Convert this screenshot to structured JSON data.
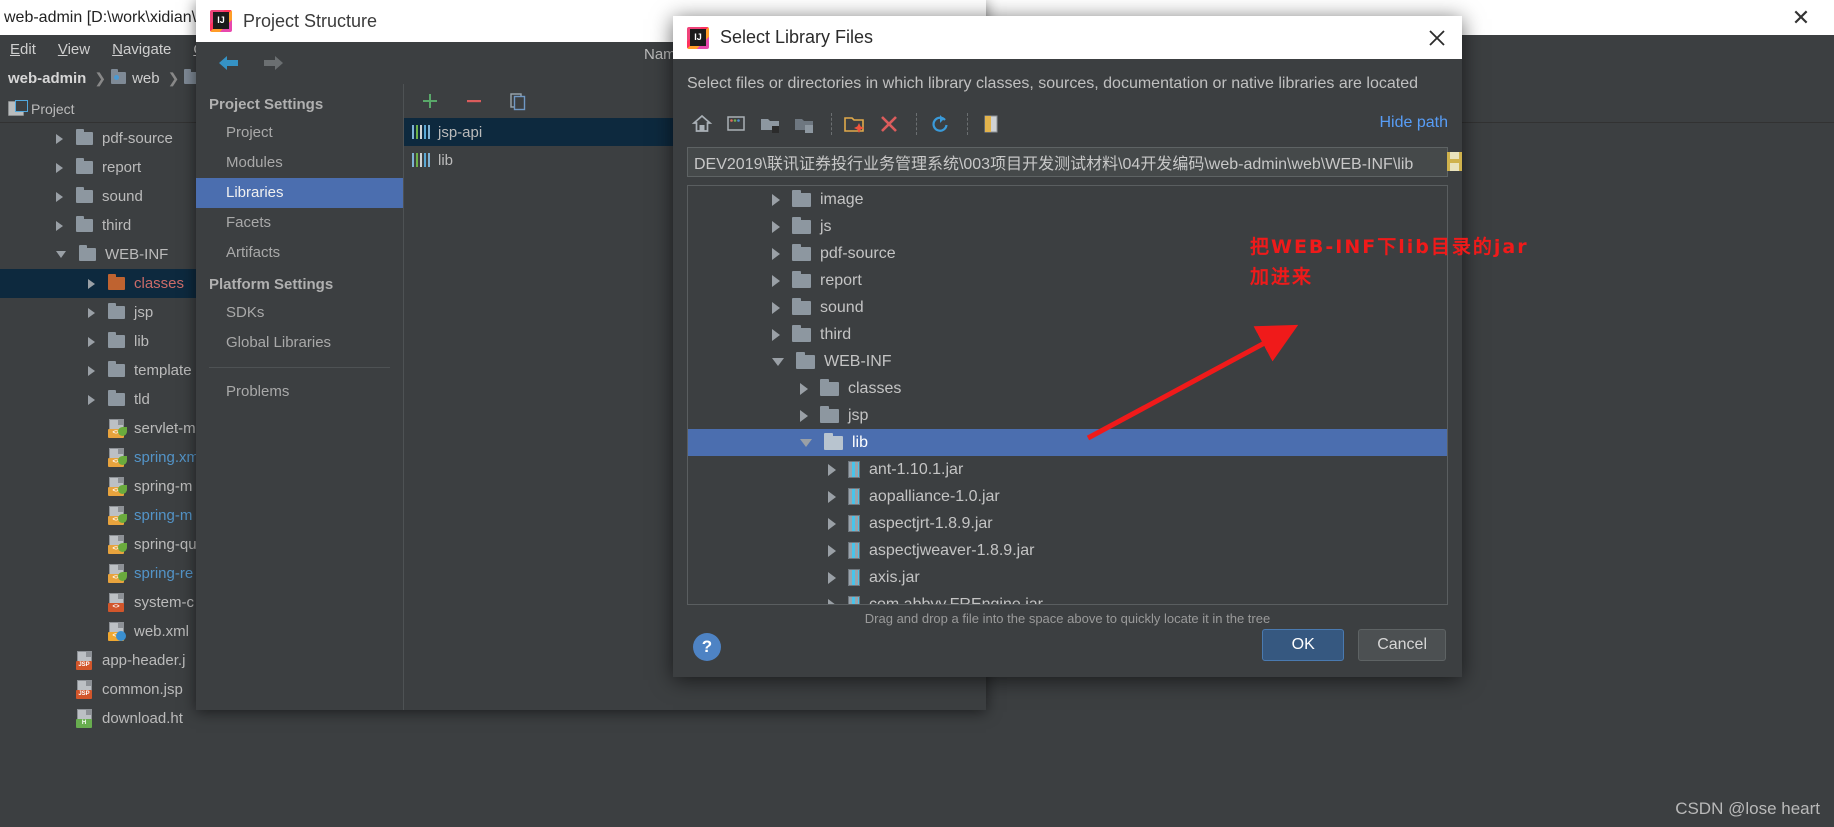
{
  "ide": {
    "title": "web-admin [D:\\work\\xidian\\",
    "window_close_icon": "close-icon",
    "menu": [
      {
        "label": "Edit",
        "mnemonic": "E"
      },
      {
        "label": "View",
        "mnemonic": "V"
      },
      {
        "label": "Navigate",
        "mnemonic": "N"
      },
      {
        "label": "Co",
        "mnemonic": "C"
      }
    ],
    "breadcrumb": [
      "web-admin",
      "web",
      ""
    ],
    "toolwindow_title": "Project",
    "tree": [
      {
        "label": "pdf-source",
        "type": "folder",
        "state": "collapsed",
        "indent": 1,
        "color": "normal"
      },
      {
        "label": "report",
        "type": "folder",
        "state": "collapsed",
        "indent": 1,
        "color": "normal"
      },
      {
        "label": "sound",
        "type": "folder",
        "state": "collapsed",
        "indent": 1,
        "color": "normal"
      },
      {
        "label": "third",
        "type": "folder",
        "state": "collapsed",
        "indent": 1,
        "color": "normal"
      },
      {
        "label": "WEB-INF",
        "type": "folder",
        "state": "expanded",
        "indent": 1,
        "color": "normal"
      },
      {
        "label": "classes",
        "type": "folder-orange",
        "state": "collapsed",
        "indent": 2,
        "color": "red",
        "selected": true
      },
      {
        "label": "jsp",
        "type": "folder",
        "state": "collapsed",
        "indent": 2,
        "color": "normal"
      },
      {
        "label": "lib",
        "type": "folder",
        "state": "collapsed",
        "indent": 2,
        "color": "normal"
      },
      {
        "label": "template",
        "type": "folder",
        "state": "collapsed",
        "indent": 2,
        "color": "normal"
      },
      {
        "label": "tld",
        "type": "folder",
        "state": "collapsed",
        "indent": 2,
        "color": "normal"
      },
      {
        "label": "servlet-m",
        "type": "spring",
        "state": "leaf",
        "indent": 2,
        "color": "normal"
      },
      {
        "label": "spring.xm",
        "type": "spring",
        "state": "leaf",
        "indent": 2,
        "color": "blue"
      },
      {
        "label": "spring-m",
        "type": "spring",
        "state": "leaf",
        "indent": 2,
        "color": "normal"
      },
      {
        "label": "spring-m",
        "type": "spring",
        "state": "leaf",
        "indent": 2,
        "color": "blue"
      },
      {
        "label": "spring-qu",
        "type": "spring",
        "state": "leaf",
        "indent": 2,
        "color": "normal"
      },
      {
        "label": "spring-re",
        "type": "spring",
        "state": "leaf",
        "indent": 2,
        "color": "blue"
      },
      {
        "label": "system-c",
        "type": "xml",
        "state": "leaf",
        "indent": 2,
        "color": "normal"
      },
      {
        "label": "web.xml",
        "type": "webxml",
        "state": "leaf",
        "indent": 2,
        "color": "normal"
      },
      {
        "label": "app-header.j",
        "type": "jsp",
        "state": "leaf",
        "indent": 1,
        "color": "normal"
      },
      {
        "label": "common.jsp",
        "type": "jsp",
        "state": "leaf",
        "indent": 1,
        "color": "normal"
      },
      {
        "label": "download.ht",
        "type": "html",
        "state": "leaf",
        "indent": 1,
        "color": "normal"
      }
    ]
  },
  "project_structure": {
    "title": "Project Structure",
    "logo_icon": "intellij-logo-icon",
    "nav": {
      "back_icon": "arrow-left-icon",
      "forward_icon": "arrow-right-icon"
    },
    "groups": [
      {
        "label": "Project Settings",
        "items": [
          "Project",
          "Modules",
          "Libraries",
          "Facets",
          "Artifacts"
        ]
      },
      {
        "label": "Platform Settings",
        "items": [
          "SDKs",
          "Global Libraries"
        ]
      }
    ],
    "active_item": "Libraries",
    "problems_label": "Problems",
    "content_column_header": "Nam",
    "toolbar": [
      {
        "icon": "plus-icon",
        "label": "+"
      },
      {
        "icon": "minus-icon",
        "label": "−"
      },
      {
        "icon": "copy-icon",
        "label": "copy"
      }
    ],
    "libraries": [
      {
        "label": "jsp-api",
        "selected": true
      },
      {
        "label": "lib",
        "selected": false
      }
    ]
  },
  "select_library_files": {
    "title": "Select Library Files",
    "logo_icon": "intellij-logo-icon",
    "close_icon": "close-icon",
    "description": "Select files or directories in which library classes, sources, documentation or native libraries are located",
    "toolbar": [
      {
        "icon": "home-icon"
      },
      {
        "icon": "desktop-icon"
      },
      {
        "icon": "folder-up-icon"
      },
      {
        "icon": "folder-hide-icon"
      },
      {
        "icon": "new-folder-icon"
      },
      {
        "icon": "delete-icon"
      },
      {
        "icon": "refresh-icon"
      },
      {
        "icon": "show-hidden-icon"
      }
    ],
    "hide_path_label": "Hide path",
    "path_value": "DEV2019\\联讯证券投行业务管理系统\\003项目开发测试材料\\04开发编码\\web-admin\\web\\WEB-INF\\lib",
    "path_button_icon": "path-picker-icon",
    "tree": [
      {
        "label": "image",
        "type": "folder",
        "state": "collapsed",
        "indent": 3
      },
      {
        "label": "js",
        "type": "folder",
        "state": "collapsed",
        "indent": 3
      },
      {
        "label": "pdf-source",
        "type": "folder",
        "state": "collapsed",
        "indent": 3
      },
      {
        "label": "report",
        "type": "folder",
        "state": "collapsed",
        "indent": 3
      },
      {
        "label": "sound",
        "type": "folder",
        "state": "collapsed",
        "indent": 3
      },
      {
        "label": "third",
        "type": "folder",
        "state": "collapsed",
        "indent": 3
      },
      {
        "label": "WEB-INF",
        "type": "folder",
        "state": "expanded",
        "indent": 3
      },
      {
        "label": "classes",
        "type": "folder",
        "state": "collapsed",
        "indent": 4
      },
      {
        "label": "jsp",
        "type": "folder",
        "state": "collapsed",
        "indent": 4
      },
      {
        "label": "lib",
        "type": "folder",
        "state": "expanded",
        "indent": 4,
        "selected": true
      },
      {
        "label": "ant-1.10.1.jar",
        "type": "jar",
        "state": "collapsed",
        "indent": 5
      },
      {
        "label": "aopalliance-1.0.jar",
        "type": "jar",
        "state": "collapsed",
        "indent": 5
      },
      {
        "label": "aspectjrt-1.8.9.jar",
        "type": "jar",
        "state": "collapsed",
        "indent": 5
      },
      {
        "label": "aspectjweaver-1.8.9.jar",
        "type": "jar",
        "state": "collapsed",
        "indent": 5
      },
      {
        "label": "axis.jar",
        "type": "jar",
        "state": "collapsed",
        "indent": 5
      },
      {
        "label": "com.abbyy.FREngine.jar",
        "type": "jar",
        "state": "collapsed",
        "indent": 5
      }
    ],
    "hint": "Drag and drop a file into the space above to quickly locate it in the tree",
    "help_icon": "help-icon",
    "buttons": [
      {
        "label": "OK",
        "primary": true
      },
      {
        "label": "Cancel",
        "primary": false
      }
    ]
  },
  "annotation": {
    "text": "把WEB-INF下lib目录的jar加进来",
    "color": "#f01a1a",
    "arrow_icon": "arrow-pointer-icon"
  },
  "watermark": "CSDN @lose heart"
}
